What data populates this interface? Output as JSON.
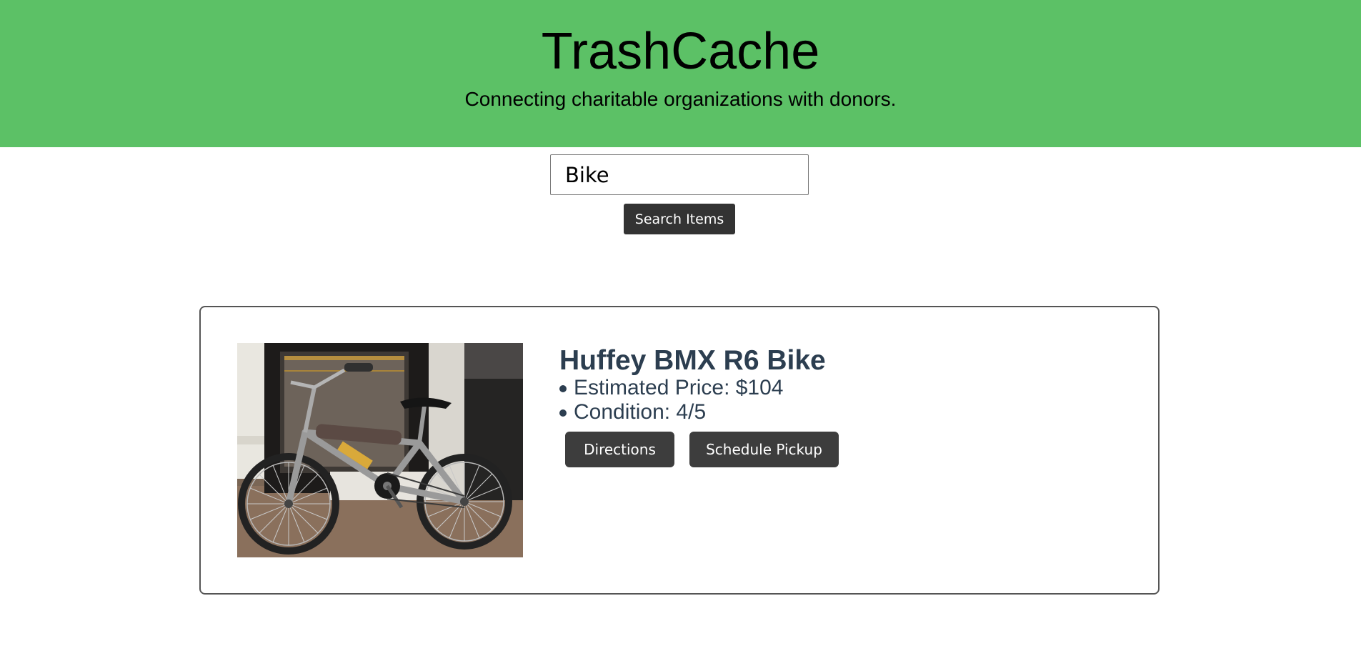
{
  "header": {
    "title": "TrashCache",
    "subtitle": "Connecting charitable organizations with donors.",
    "background_color": "#5cc166"
  },
  "search": {
    "value": "Bike",
    "button_label": "Search Items"
  },
  "results": [
    {
      "name": "Huffey BMX R6 Bike",
      "photo": "bmx-bike-photo",
      "details": [
        "Estimated Price: $104",
        "Condition: 4/5"
      ],
      "actions": {
        "directions_label": "Directions",
        "pickup_label": "Schedule Pickup"
      }
    }
  ],
  "colors": {
    "button": "#333333",
    "text_dark": "#2c3e50",
    "card_border": "#555555"
  }
}
